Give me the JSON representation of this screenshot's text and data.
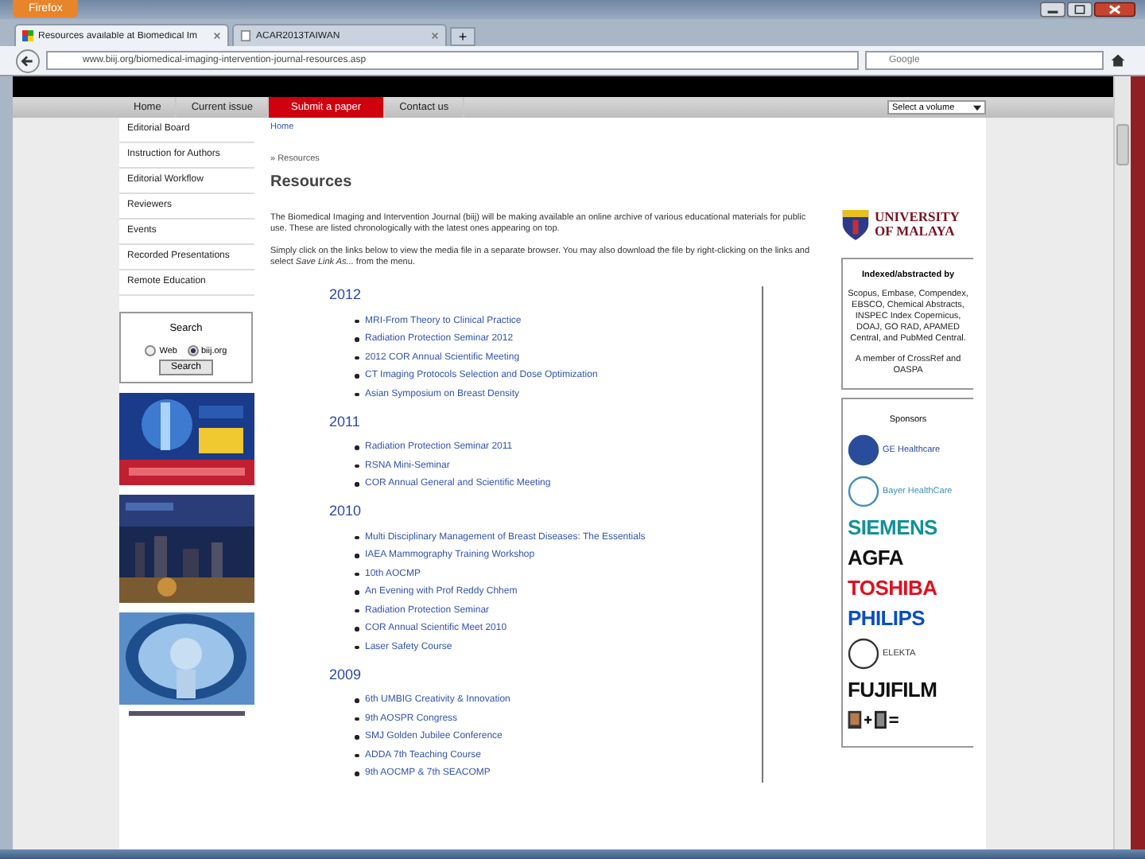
{
  "browser": {
    "menu_button": "Firefox",
    "tabs": [
      {
        "label": "Resources available at Biomedical Im",
        "selected": true
      },
      {
        "label": "ACAR2013TAIWAN",
        "selected": false
      }
    ],
    "new_tab": "+",
    "address": "www.biij.org/biomedical-imaging-intervention-journal-resources.asp",
    "search": {
      "placeholder": "Google"
    }
  },
  "site": {
    "nav": [
      {
        "label": "Home",
        "selected": false
      },
      {
        "label": "Current issue",
        "selected": false
      },
      {
        "label": "Submit a paper",
        "selected": true
      },
      {
        "label": "Contact us",
        "selected": false
      }
    ],
    "volume_select": "Select a volume",
    "sidebar": {
      "items": [
        "Editorial Board",
        "Instruction for Authors",
        "Editorial Workflow",
        "Reviewers",
        "Events",
        "Recorded Presentations",
        "Remote Education"
      ],
      "search": {
        "title": "Search",
        "options": [
          {
            "label": "Web",
            "selected": false
          },
          {
            "label": "biij.org",
            "selected": true
          }
        ],
        "button": "Search"
      },
      "banners": [
        {
          "kind": "picture"
        },
        {
          "kind": "picture"
        },
        {
          "kind": "picture"
        }
      ]
    },
    "breadcrumb": "Home",
    "trail": "» Resources",
    "heading": "Resources",
    "paragraphs": [
      "The Biomedical Imaging and Intervention Journal (biij) will be making available an online archive of various educational materials for public use. These are listed chronologically with the latest ones appearing on top.",
      "Simply click on the links below to view the media file in a separate browser. You may also download the file by right-clicking on the links and select *Save Link As...* from the menu."
    ],
    "years": [
      {
        "year": "2012",
        "items": [
          "MRI-From Theory to Clinical Practice",
          "Radiation Protection Seminar 2012",
          "2012 COR Annual Scientific Meeting",
          "CT Imaging Protocols Selection and Dose Optimization",
          "Asian Symposium on Breast Density"
        ]
      },
      {
        "year": "2011",
        "items": [
          "Radiation Protection Seminar 2011",
          "RSNA Mini-Seminar",
          "COR Annual General and Scientific Meeting"
        ]
      },
      {
        "year": "2010",
        "items": [
          "Multi Disciplinary Management of Breast Diseases: The Essentials",
          "IAEA Mammography Training Workshop",
          "10th AOCMP",
          "An Evening with Prof Reddy Chhem",
          "Radiation Protection Seminar",
          "COR Annual Scientific Meet 2010",
          "Laser Safety Course"
        ]
      },
      {
        "year": "2009",
        "items": [
          "6th UMBIG Creativity & Innovation",
          "9th AOSPR Congress",
          "SMJ Golden Jubilee Conference",
          "ADDA 7th Teaching Course",
          "9th AOCMP & 7th SEACOMP"
        ]
      }
    ],
    "university": "UNIVERSITY OF MALAYA",
    "indexing": {
      "title": "Indexed/abstracted by",
      "text": "Scopus, Embase, Compendex, EBSCO, Chemical Abstracts, INSPEC Index Copernicus, DOAJ, GO RAD, APAMED Central, and PubMed Central.",
      "member": "A member of CrossRef and OASPA"
    },
    "sponsors": {
      "title": "Sponsors",
      "items": [
        {
          "name": "GE Healthcare",
          "kind": "emblem",
          "color": "#2a4d9b"
        },
        {
          "name": "Bayer HealthCare",
          "kind": "emblem",
          "color": "#3f8fb5"
        },
        {
          "name": "SIEMENS",
          "kind": "wordmark",
          "color": "#13909a"
        },
        {
          "name": "AGFA",
          "kind": "wordmark",
          "color": "#111111"
        },
        {
          "name": "TOSHIBA",
          "kind": "wordmark",
          "color": "#e01020"
        },
        {
          "name": "PHILIPS",
          "kind": "wordmark",
          "color": "#0b4fbf"
        },
        {
          "name": "ELEKTA",
          "kind": "emblem",
          "color": "#333333"
        },
        {
          "name": "FUJIFILM",
          "kind": "wordmark",
          "color": "#111111"
        }
      ]
    }
  }
}
